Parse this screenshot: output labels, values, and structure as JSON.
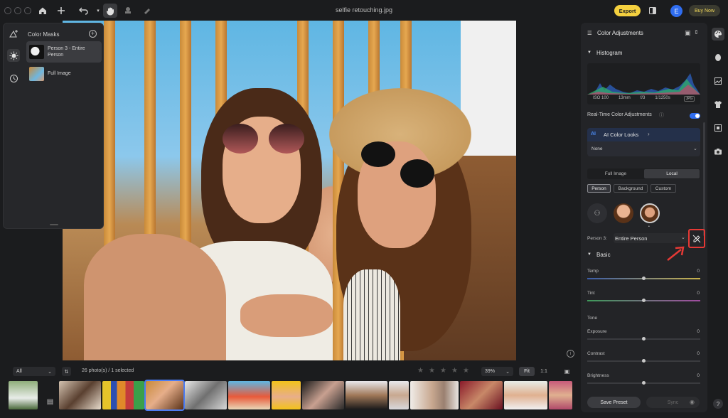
{
  "window": {
    "title": "selfie retouching.jpg"
  },
  "toolbar": {
    "export_label": "Export",
    "avatar_letter": "E",
    "buy_label": "Buy Now"
  },
  "masks": {
    "title": "Color Masks",
    "items": [
      {
        "label": "Person 3 - Entire Person",
        "selected": true
      },
      {
        "label": "Full Image",
        "selected": false
      }
    ]
  },
  "adjustments": {
    "title": "Color Adjustments",
    "histogram": {
      "title": "Histogram",
      "iso": "ISO 100",
      "focal": "13mm",
      "aperture": "f/3",
      "shutter": "1/1250s",
      "format": "JPG"
    },
    "realtime_label": "Real-Time Color Adjustments",
    "realtime_on": true,
    "ai_looks": {
      "title": "AI Color Looks",
      "value": "None"
    },
    "scope_tabs": [
      {
        "label": "Full Image",
        "active": false
      },
      {
        "label": "Local",
        "active": true
      }
    ],
    "mask_types": [
      {
        "label": "Person",
        "active": true
      },
      {
        "label": "Background",
        "active": false
      },
      {
        "label": "Custom",
        "active": false
      }
    ],
    "person_label": "Person 3:",
    "person_value": "Entire Person",
    "basic_title": "Basic",
    "sliders": [
      {
        "label": "Temp",
        "value": "0",
        "pos": 0.5
      },
      {
        "label": "Tint",
        "value": "0",
        "pos": 0.5
      }
    ],
    "tone_label": "Tone",
    "tone_sliders": [
      {
        "label": "Exposure",
        "value": "0",
        "pos": 0.5
      },
      {
        "label": "Contrast",
        "value": "0",
        "pos": 0.5
      },
      {
        "label": "Brightness",
        "value": "0",
        "pos": 0.5
      }
    ],
    "save_preset_label": "Save Preset",
    "sync_label": "Sync"
  },
  "filmstrip": {
    "filter_value": "All",
    "count_label": "26 photo(s) / 1 selected",
    "zoom_value": "39%",
    "fit_label": "Fit",
    "one_label": "1:1"
  },
  "icons": {
    "home": "home-icon",
    "add": "plus-icon",
    "undo": "undo-icon",
    "hand": "hand-icon",
    "brush": "stamp-icon",
    "eraser": "eraser-icon",
    "palette": "palette-icon"
  }
}
